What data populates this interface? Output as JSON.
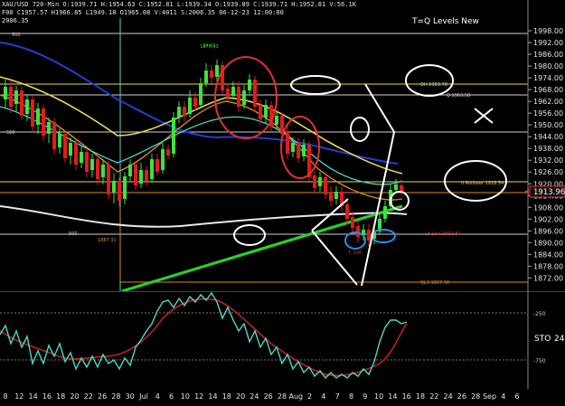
{
  "header": {
    "line1": "XAU/USD 720-Min O:1939.71 H:1954.63 C:1952.81 L:1939.34 O:1939.89 C:1939.71 H:1952.81 V:56.1K",
    "line2": "F00 C1957.57 H1966.85 L1949.18 O1965.08 V:4011 S:2006.35 06-12-23 12:00:00",
    "line3": "2006.35"
  },
  "chart_title": "T=Q Levels New",
  "price_axis": {
    "ticks": [
      "1998.00",
      "1992.00",
      "1986.00",
      "1980.00",
      "1974.00",
      "1968.00",
      "1962.00",
      "1956.00",
      "1950.00",
      "1944.00",
      "1938.00",
      "1932.00",
      "1926.00",
      "1920.00",
      "1914.00",
      "1908.00",
      "1902.00",
      "1896.00",
      "1890.00",
      "1884.00",
      "1878.00",
      "1872.00"
    ],
    "current_price": "1913.96",
    "current_price_color": "#e3342f"
  },
  "level_labels": {
    "left_500_top": "500",
    "left_500_mid": "500",
    "left_500_low": "500",
    "left_low": "1887.31",
    "top_level": "1975.43",
    "candle_high": "34.43",
    "qh_level": "QH 1969.78",
    "q_level": "Q 1963.58",
    "rollover": "0 Rollover 1918.54",
    "l3_level": "L3 Low 1892.84",
    "ql3": "QL3 1867.30",
    "mini_label": "T: 195"
  },
  "sto": {
    "label": "STO",
    "period": "24",
    "tick_high": "-250",
    "tick_low": "-750"
  },
  "date_axis": {
    "labels": [
      "8",
      "12",
      "14",
      "16",
      "18",
      "20",
      "22",
      "26",
      "28",
      "30",
      "Jul",
      "4",
      "6",
      "10",
      "12",
      "14",
      "18",
      "20",
      "24",
      "26",
      "28",
      "Aug",
      "2",
      "4",
      "7",
      "8",
      "9",
      "10",
      "14",
      "16",
      "18",
      "22",
      "24",
      "26",
      "28",
      "Sep",
      "4",
      "6"
    ]
  },
  "colors": {
    "background": "#000000",
    "bull_candle": "#3ee13e",
    "bear_candle": "#e01b1b",
    "ma_blue": "#1f3fd6",
    "ma_yellow": "#e6d35a",
    "ma_cyan": "#4fd6c9",
    "ma_orange": "#d98a2b",
    "ma_white": "#e8e8e8",
    "trend_green": "#28d128",
    "annotation_red": "#e23030",
    "annotation_blue": "#2a8fe6",
    "annotation_white": "#ffffff"
  }
}
